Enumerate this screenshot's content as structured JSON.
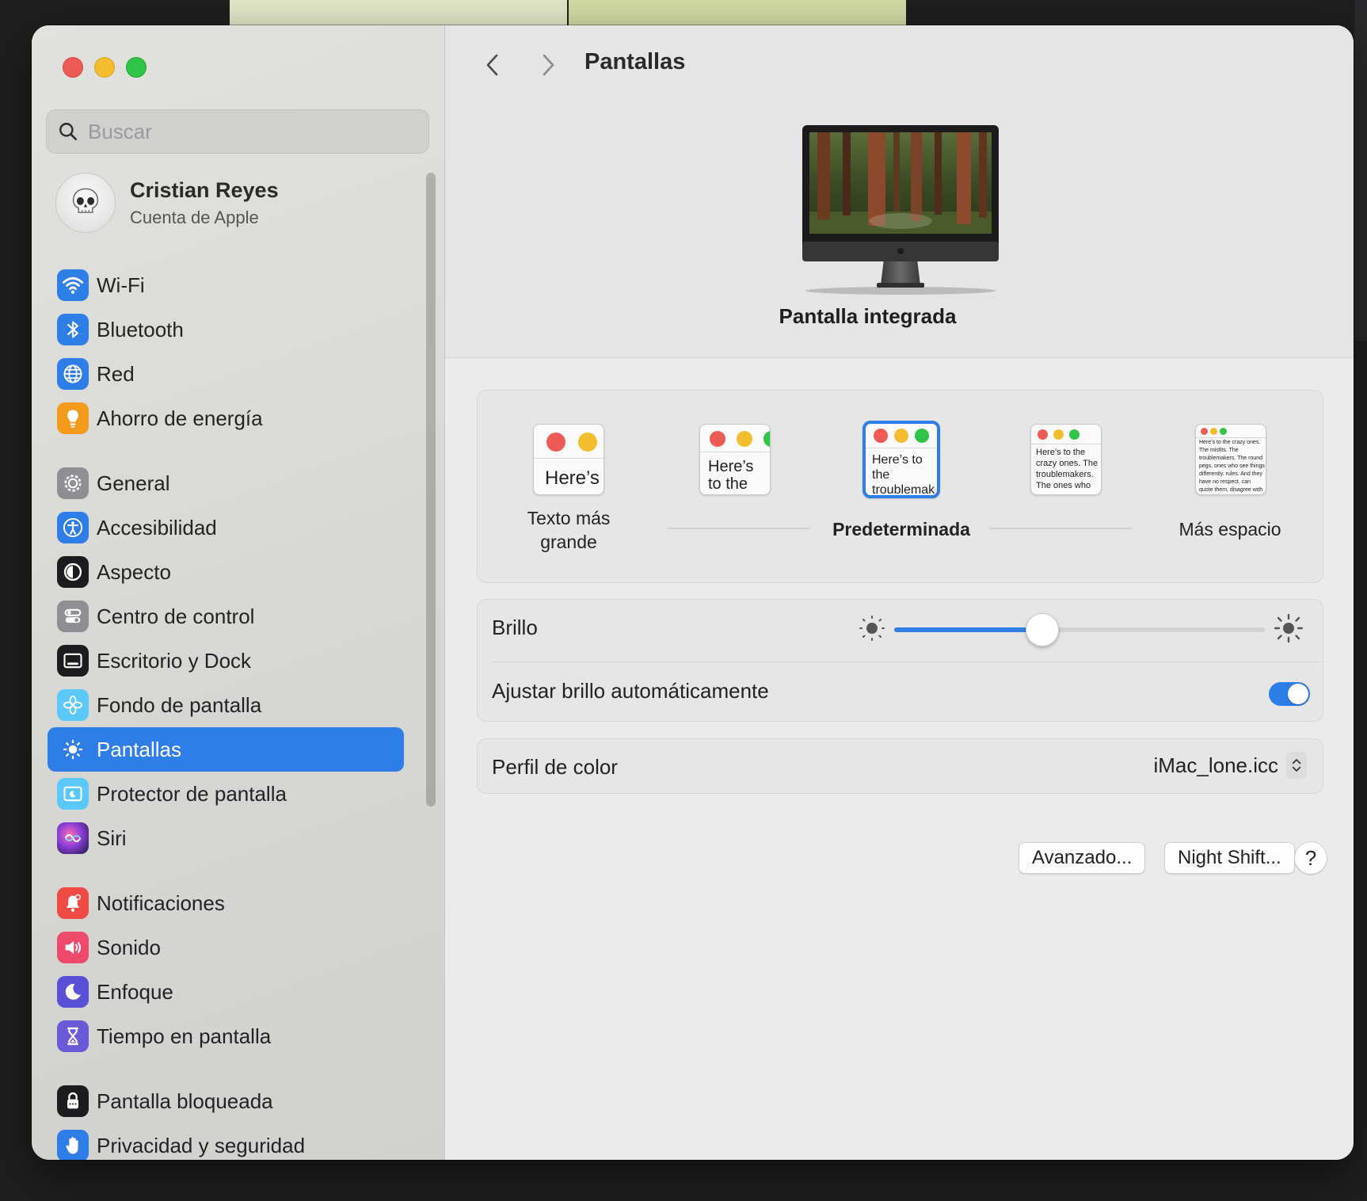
{
  "window": {
    "title": "Pantallas"
  },
  "search": {
    "placeholder": "Buscar"
  },
  "account": {
    "name": "Cristian Reyes",
    "subtitle": "Cuenta de Apple"
  },
  "sidebar": {
    "items": [
      {
        "label": "Wi-Fi",
        "icon": "wifi-icon",
        "color": "#2f7ee8"
      },
      {
        "label": "Bluetooth",
        "icon": "bluetooth-icon",
        "color": "#2f7ee8"
      },
      {
        "label": "Red",
        "icon": "globe-icon",
        "color": "#2f7ee8"
      },
      {
        "label": "Ahorro de energía",
        "icon": "lightbulb-icon",
        "color": "#f49a1c"
      },
      {
        "label": "General",
        "icon": "gear-icon",
        "color": "#8e8e93"
      },
      {
        "label": "Accesibilidad",
        "icon": "accessibility-icon",
        "color": "#2f7ee8"
      },
      {
        "label": "Aspecto",
        "icon": "appearance-icon",
        "color": "#1c1c1e"
      },
      {
        "label": "Centro de control",
        "icon": "control-center-icon",
        "color": "#8e8e93"
      },
      {
        "label": "Escritorio y Dock",
        "icon": "dock-icon",
        "color": "#1c1c1e"
      },
      {
        "label": "Fondo de pantalla",
        "icon": "wallpaper-icon",
        "color": "#5ac8fa"
      },
      {
        "label": "Pantallas",
        "icon": "sun-icon",
        "color": "#2f7ee8"
      },
      {
        "label": "Protector de pantalla",
        "icon": "screensaver-icon",
        "color": "#5ac8fa"
      },
      {
        "label": "Siri",
        "icon": "siri-icon",
        "color": "#6a3db0"
      },
      {
        "label": "Notificaciones",
        "icon": "bell-icon",
        "color": "#ee4b45"
      },
      {
        "label": "Sonido",
        "icon": "speaker-icon",
        "color": "#ee4a6b"
      },
      {
        "label": "Enfoque",
        "icon": "moon-icon",
        "color": "#5b4fd6"
      },
      {
        "label": "Tiempo en pantalla",
        "icon": "hourglass-icon",
        "color": "#6b5ad8"
      },
      {
        "label": "Pantalla bloqueada",
        "icon": "lock-icon",
        "color": "#1c1c1e"
      },
      {
        "label": "Privacidad y seguridad",
        "icon": "hand-icon",
        "color": "#2f7ee8"
      }
    ],
    "selected_index": 10
  },
  "display": {
    "name": "Pantalla integrada"
  },
  "resolution": {
    "options": [
      {
        "label": "Texto más grande",
        "preview": "Here’s"
      },
      {
        "label": "",
        "preview": "Here’s to the troublem"
      },
      {
        "label": "Predeterminada",
        "preview": "Here’s to the troublemakers. The ones who"
      },
      {
        "label": "",
        "preview": "Here’s to the crazy ones. The troublemakers. The ones who see things differently. rules. And they"
      },
      {
        "label": "Más espacio",
        "preview": "Here’s to the crazy ones. The misfits. The troublemakers. The round pegs. ones who see things differently. rules. And they have no respect. can quote them, disagree with them. About the only thing Because they change things."
      }
    ],
    "selected_index": 2
  },
  "brightness": {
    "label": "Brillo",
    "value": 0.4,
    "auto_label": "Ajustar brillo automáticamente",
    "auto_enabled": true
  },
  "color_profile": {
    "label": "Perfil de color",
    "value": "iMac_lone.icc"
  },
  "buttons": {
    "advanced": "Avanzado...",
    "night_shift": "Night Shift...",
    "help": "?"
  },
  "colors": {
    "accent": "#2f7ee8"
  }
}
